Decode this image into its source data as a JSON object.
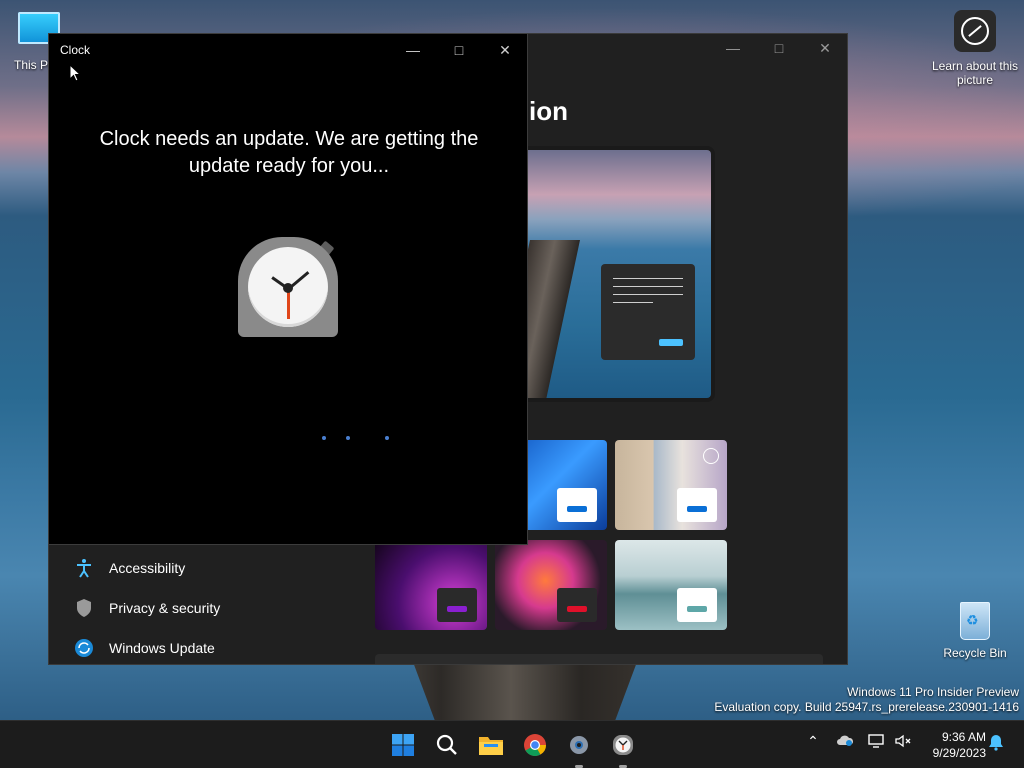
{
  "desktop": {
    "this_pc_label": "This PC",
    "learn_label": "Learn about this picture",
    "recycle_label": "Recycle Bin",
    "watermark_line1": "Windows 11 Pro Insider Preview",
    "watermark_line2": "Evaluation copy. Build 25947.rs_prerelease.230901-1416"
  },
  "settings": {
    "heading_fragment": "ion",
    "nav": [
      {
        "label": "Accessibility",
        "icon": "accessibility-icon"
      },
      {
        "label": "Privacy & security",
        "icon": "shield-icon"
      },
      {
        "label": "Windows Update",
        "icon": "windows-update-icon"
      }
    ],
    "accent": "#4cc2ff"
  },
  "clock_window": {
    "title": "Clock",
    "message": "Clock needs an update. We are getting the update ready for you..."
  },
  "taskbar": {
    "time": "9:36 AM",
    "date": "9/29/2023",
    "apps": [
      "start-icon",
      "search-icon",
      "file-explorer-icon",
      "chrome-icon",
      "settings-icon",
      "clock-app-icon"
    ]
  }
}
